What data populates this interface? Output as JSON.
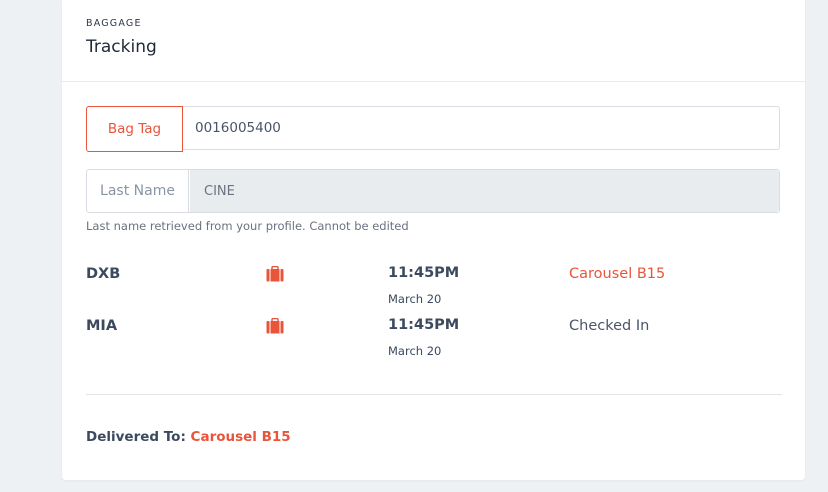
{
  "header": {
    "eyebrow": "BAGGAGE",
    "title": "Tracking"
  },
  "bag_tag": {
    "tab_label": "Bag Tag",
    "value": "0016005400"
  },
  "last_name": {
    "label": "Last Name",
    "value": "CINE",
    "hint": "Last name retrieved from your profile. Cannot be edited"
  },
  "legs": [
    {
      "code": "DXB",
      "icon": "luggage-icon",
      "time": "11:45PM",
      "date": "March 20",
      "status": "Carousel B15",
      "status_color": "#e8553b"
    },
    {
      "code": "MIA",
      "icon": "luggage-icon",
      "time": "11:45PM",
      "date": "March 20",
      "status": "Checked In",
      "status_color": "#4a5568"
    }
  ],
  "delivery": {
    "label": "Delivered To:",
    "value": "Carousel B15"
  },
  "colors": {
    "accent": "#e8553b",
    "text_dark": "#3b4a5e",
    "background": "#eef1f4"
  }
}
